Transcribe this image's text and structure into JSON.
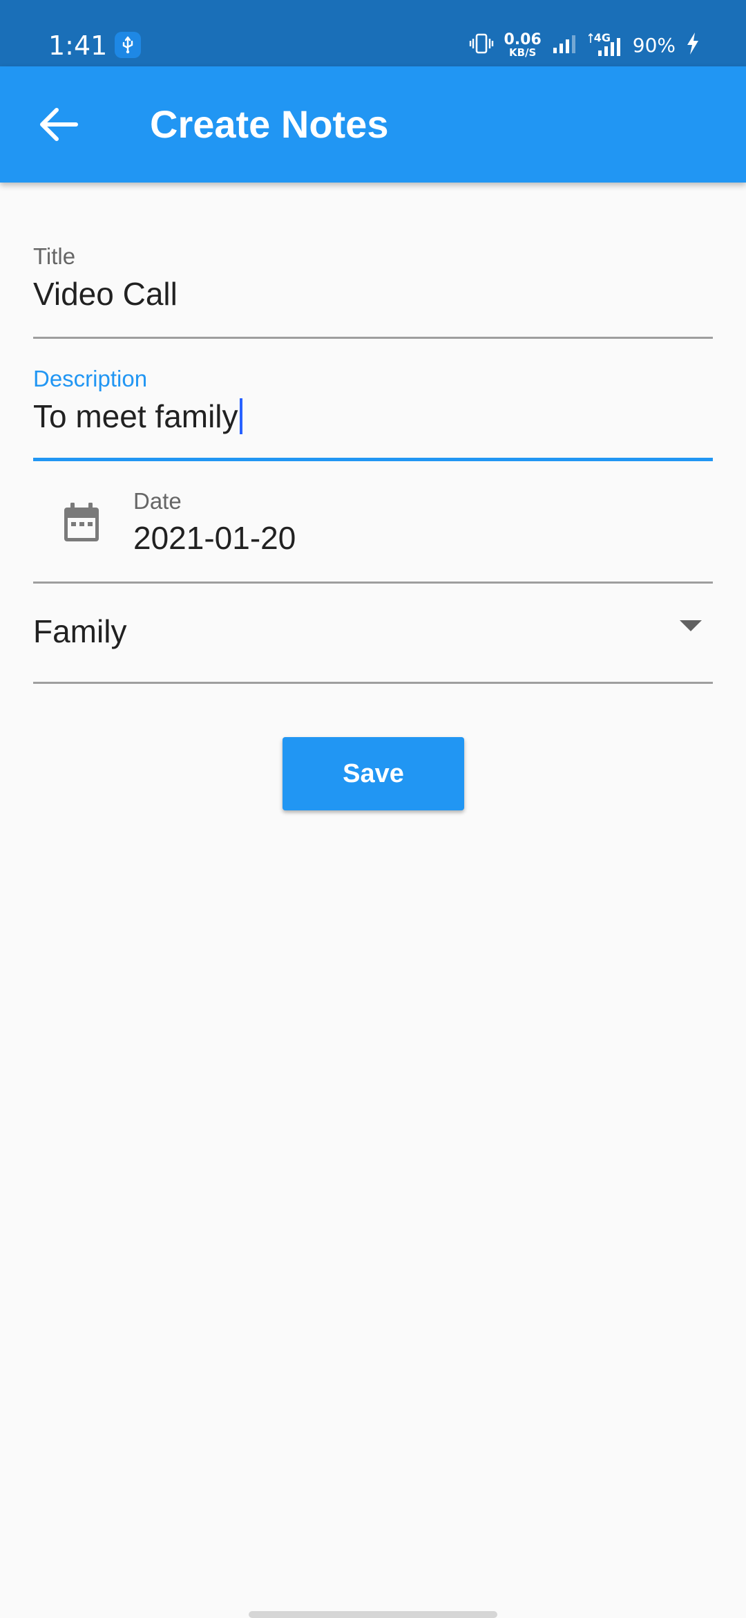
{
  "status_bar": {
    "time": "1:41",
    "net_speed_value": "0.06",
    "net_speed_unit": "KB/S",
    "network_type": "4G",
    "battery": "90%"
  },
  "app_bar": {
    "title": "Create Notes",
    "back_icon": "arrow-back-icon"
  },
  "form": {
    "title": {
      "label": "Title",
      "value": "Video Call"
    },
    "description": {
      "label": "Description",
      "value": "To meet family",
      "focused": true
    },
    "date": {
      "label": "Date",
      "value": "2021-01-20",
      "icon": "calendar-icon"
    },
    "category": {
      "selected": "Family",
      "icon": "arrow-drop-down-icon"
    },
    "save_label": "Save"
  },
  "colors": {
    "status_bar": "#1a6fb8",
    "app_bar": "#2196f3",
    "accent": "#2196f3",
    "background": "#fafafa",
    "cursor": "#2962ff"
  }
}
